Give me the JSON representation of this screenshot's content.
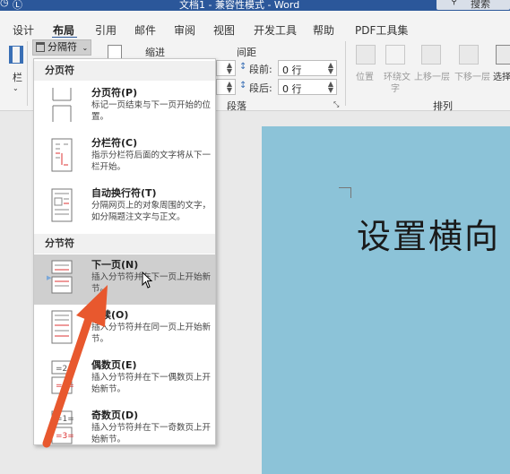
{
  "titlebar": {
    "title": "文档1 - 兼容性模式 - Word",
    "search_label": "搜索"
  },
  "tabs": [
    {
      "label": "设计"
    },
    {
      "label": "布局",
      "active": true
    },
    {
      "label": "引用"
    },
    {
      "label": "邮件"
    },
    {
      "label": "审阅"
    },
    {
      "label": "视图"
    },
    {
      "label": "开发工具"
    },
    {
      "label": "帮助"
    },
    {
      "label": "PDF工具集"
    }
  ],
  "ribbon": {
    "columns_label": "栏",
    "breaks_button": "分隔符",
    "indent_label": "缩进",
    "spacing_label": "间距",
    "before_label": "段前:",
    "before_value": "0 行",
    "after_label": "段后:",
    "after_value": "0 行",
    "paragraph_group": "段落",
    "arrange_group": "排列",
    "position": "位置",
    "wrap_text_1": "环绕文",
    "wrap_text_2": "字",
    "bring_forward": "上移一层",
    "send_backward": "下移一层",
    "select": "选择"
  },
  "menu": {
    "page_breaks_header": "分页符",
    "section_breaks_header": "分节符",
    "items": [
      {
        "title": "分页符(P)",
        "desc": "标记一页结束与下一页开始的位置。"
      },
      {
        "title": "分栏符(C)",
        "desc": "指示分栏符后面的文字将从下一栏开始。"
      },
      {
        "title": "自动换行符(T)",
        "desc": "分隔网页上的对象周围的文字，如分隔题注文字与正文。"
      },
      {
        "title": "下一页(N)",
        "desc": "插入分节符并在下一页上开始新节。"
      },
      {
        "title": "连续(O)",
        "desc": "插入分节符并在同一页上开始新节。"
      },
      {
        "title": "偶数页(E)",
        "desc": "插入分节符并在下一偶数页上开始新节。"
      },
      {
        "title": "奇数页(D)",
        "desc": "插入分节符并在下一奇数页上开始新节。"
      }
    ]
  },
  "document": {
    "text": "设置横向"
  },
  "colors": {
    "accent": "#2b579a",
    "page": "#8cc3d8",
    "arrow": "#e8582e"
  }
}
